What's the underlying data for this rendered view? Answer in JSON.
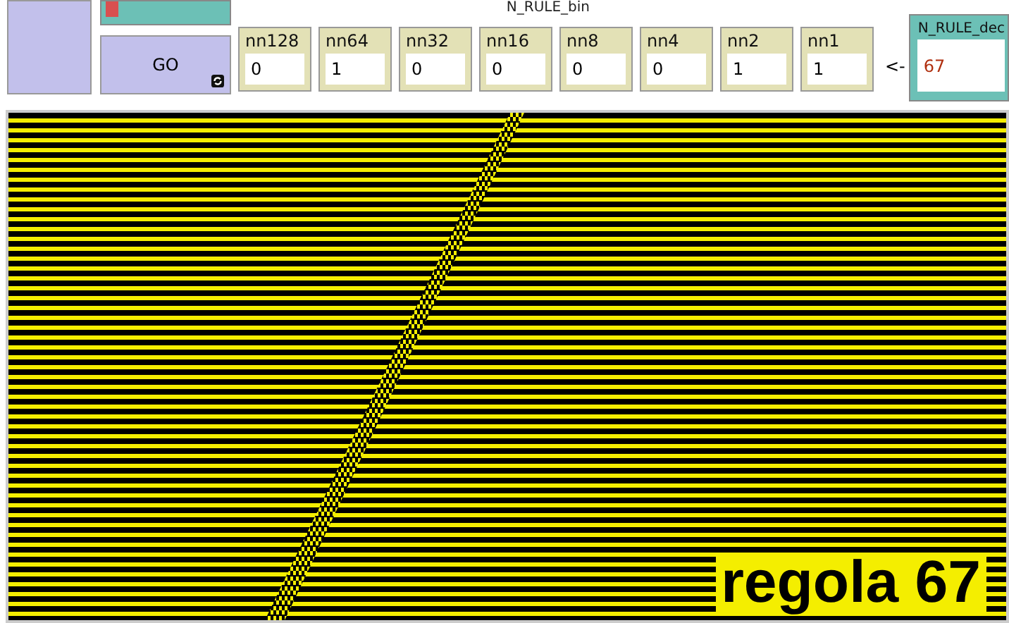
{
  "switch": {
    "on": false
  },
  "go_button": {
    "label": "GO"
  },
  "rule_bin": {
    "title": "N_RULE_bin",
    "inputs": [
      {
        "label": "nn128",
        "value": "0"
      },
      {
        "label": "nn64",
        "value": "1"
      },
      {
        "label": "nn32",
        "value": "0"
      },
      {
        "label": "nn16",
        "value": "0"
      },
      {
        "label": "nn8",
        "value": "0"
      },
      {
        "label": "nn4",
        "value": "0"
      },
      {
        "label": "nn2",
        "value": "1"
      },
      {
        "label": "nn1",
        "value": "1"
      }
    ]
  },
  "arrow": "<-",
  "rule_dec": {
    "label": "N_RULE_dec",
    "value": "67"
  },
  "view": {
    "caption": "regola 67"
  }
}
